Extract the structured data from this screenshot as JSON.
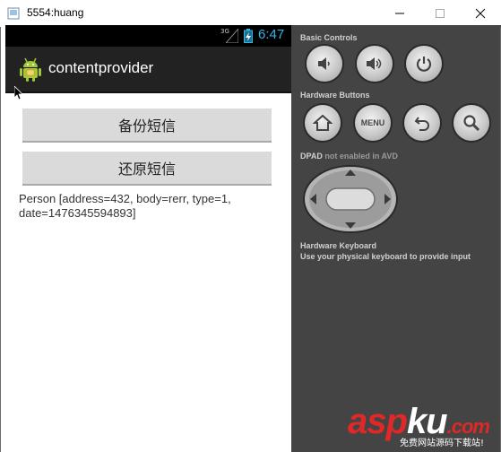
{
  "window": {
    "title": "5554:huang",
    "minimize_icon": "minimize-icon",
    "maximize_icon": "maximize-icon",
    "close_icon": "close-icon"
  },
  "status_bar": {
    "network": "3G",
    "time": "6:47",
    "time_color": "#33b5e5"
  },
  "action_bar": {
    "title": "contentprovider",
    "icon": "android-icon"
  },
  "app": {
    "backup_button": "备份短信",
    "restore_button": "还原短信",
    "result_text": "Person [address=432, body=rerr, type=1, date=1476345594893]"
  },
  "controls": {
    "basic_controls_title": "Basic Controls",
    "basic_controls": [
      "volume-down-icon",
      "volume-up-icon",
      "power-icon"
    ],
    "hardware_buttons_title": "Hardware Buttons",
    "hardware_buttons": [
      "home-icon",
      "MENU",
      "back-icon",
      "search-icon"
    ],
    "menu_label": "MENU",
    "dpad_title": "DPAD",
    "dpad_status": "not enabled in AVD",
    "keyboard_title": "Hardware Keyboard",
    "keyboard_hint": "Use your physical keyboard to provide input"
  },
  "watermark": {
    "brand_red": "asp",
    "brand_white": "ku",
    "brand_suffix": ".com",
    "tagline": "免费网站源码下载站!"
  }
}
